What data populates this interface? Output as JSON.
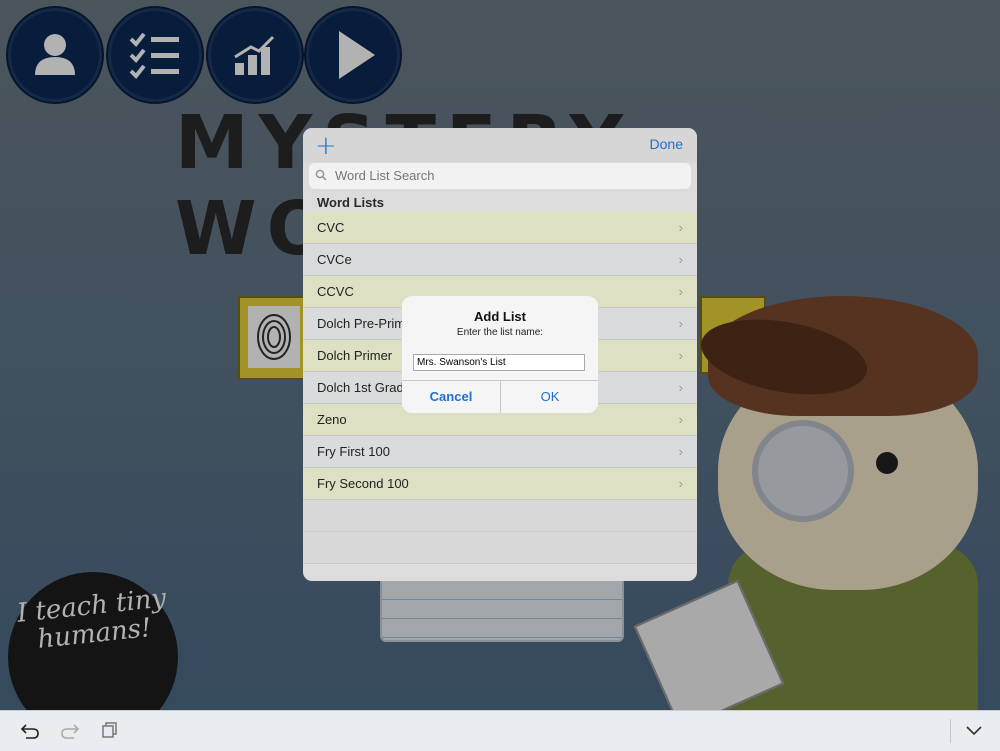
{
  "background": {
    "title": "MYSTERY WORDS",
    "badge_text": "I teach tiny humans!",
    "nav_buttons": [
      {
        "icon": "user-icon"
      },
      {
        "icon": "checklist-icon"
      },
      {
        "icon": "bar-chart-icon"
      },
      {
        "icon": "play-icon"
      }
    ]
  },
  "popover": {
    "add_label": "+",
    "done_label": "Done",
    "search_placeholder": "Word List Search",
    "section_header": "Word Lists",
    "rows": [
      {
        "label": "CVC"
      },
      {
        "label": "CVCe"
      },
      {
        "label": "CCVC"
      },
      {
        "label": "Dolch Pre-Primer"
      },
      {
        "label": "Dolch Primer"
      },
      {
        "label": "Dolch 1st Grade"
      },
      {
        "label": "Zeno"
      },
      {
        "label": "Fry First 100"
      },
      {
        "label": "Fry Second 100"
      }
    ],
    "chevron": "›"
  },
  "alert": {
    "title": "Add List",
    "message": "Enter the list name:",
    "input_value": "Mrs. Swanson's List",
    "cancel_label": "Cancel",
    "ok_label": "OK"
  },
  "toolbar": {
    "undo_icon": "undo-icon",
    "redo_icon": "redo-icon",
    "copy_icon": "copy-icon",
    "collapse_icon": "chevron-down-icon"
  },
  "colors": {
    "accent": "#1f6fd0",
    "nav_button": "#0b2a55",
    "row_highlight": "#dde0c2"
  }
}
